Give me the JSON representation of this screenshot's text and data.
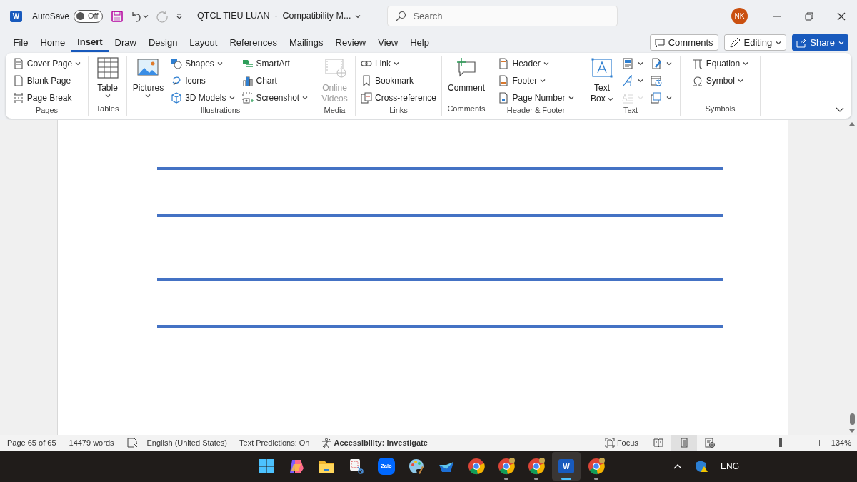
{
  "title_bar": {
    "app_letter": "W",
    "autosave": {
      "label": "AutoSave",
      "state_label": "Off",
      "on": false
    },
    "title": "QTCL TIEU LUAN  -  Compatibility M...",
    "search": {
      "placeholder": "Search"
    },
    "avatar": "NK"
  },
  "tabs": [
    {
      "label": "File",
      "selected": false
    },
    {
      "label": "Home",
      "selected": false
    },
    {
      "label": "Insert",
      "selected": true
    },
    {
      "label": "Draw",
      "selected": false
    },
    {
      "label": "Design",
      "selected": false
    },
    {
      "label": "Layout",
      "selected": false
    },
    {
      "label": "References",
      "selected": false
    },
    {
      "label": "Mailings",
      "selected": false
    },
    {
      "label": "Review",
      "selected": false
    },
    {
      "label": "View",
      "selected": false
    },
    {
      "label": "Help",
      "selected": false
    }
  ],
  "top_buttons": [
    {
      "label": "Comments",
      "kind": "outline"
    },
    {
      "label": "Editing",
      "kind": "menu"
    },
    {
      "label": "Share",
      "kind": "primary"
    }
  ],
  "ribbon": [
    {
      "label": "Pages",
      "columns": [
        {
          "kind": "stack",
          "items": [
            {
              "label": "Cover Page",
              "dropdown": true
            },
            {
              "label": "Blank Page",
              "dropdown": false
            },
            {
              "label": "Page Break",
              "dropdown": false
            }
          ]
        }
      ]
    },
    {
      "label": "Tables",
      "columns": [
        {
          "kind": "large",
          "label": "Table",
          "dropdown": true,
          "disabled": false
        }
      ]
    },
    {
      "label": "Illustrations",
      "columns": [
        {
          "kind": "large",
          "label": "Pictures",
          "dropdown": true,
          "disabled": false
        },
        {
          "kind": "stack",
          "items": [
            {
              "label": "Shapes",
              "dropdown": true
            },
            {
              "label": "Icons",
              "dropdown": false
            },
            {
              "label": "3D Models",
              "dropdown": true
            }
          ]
        },
        {
          "kind": "stack",
          "items": [
            {
              "label": "SmartArt",
              "dropdown": false
            },
            {
              "label": "Chart",
              "dropdown": false
            },
            {
              "label": "Screenshot",
              "dropdown": true
            }
          ]
        }
      ]
    },
    {
      "label": "Media",
      "columns": [
        {
          "kind": "large",
          "label": "Online Videos",
          "dropdown": false,
          "disabled": true
        }
      ]
    },
    {
      "label": "Links",
      "columns": [
        {
          "kind": "stack",
          "items": [
            {
              "label": "Link",
              "dropdown": true
            },
            {
              "label": "Bookmark",
              "dropdown": false
            },
            {
              "label": "Cross-reference",
              "dropdown": false
            }
          ]
        }
      ]
    },
    {
      "label": "Comments",
      "columns": [
        {
          "kind": "large",
          "label": "Comment",
          "dropdown": false,
          "disabled": false
        }
      ]
    },
    {
      "label": "Header & Footer",
      "columns": [
        {
          "kind": "stack",
          "items": [
            {
              "label": "Header",
              "dropdown": true
            },
            {
              "label": "Footer",
              "dropdown": true
            },
            {
              "label": "Page Number",
              "dropdown": true
            }
          ]
        }
      ]
    },
    {
      "label": "Text",
      "columns": [
        {
          "kind": "large",
          "label": "Text Box",
          "dropdown": true,
          "disabled": false
        },
        {
          "kind": "icons",
          "items": [
            {
              "dropdown": true,
              "disabled": false
            },
            {
              "dropdown": true,
              "disabled": false
            },
            {
              "dropdown": true,
              "disabled": true
            }
          ]
        },
        {
          "kind": "icons",
          "items": [
            {
              "dropdown": true,
              "disabled": false
            },
            {
              "dropdown": false,
              "disabled": false
            },
            {
              "dropdown": true,
              "disabled": false
            }
          ]
        }
      ]
    },
    {
      "label": "Symbols",
      "columns": [
        {
          "kind": "stack",
          "items": [
            {
              "label": "Equation",
              "dropdown": true
            },
            {
              "label": "Symbol",
              "dropdown": true
            }
          ]
        }
      ]
    }
  ],
  "document": {
    "rules": [
      {
        "kind": "line"
      },
      {
        "kind": "line"
      },
      {
        "kind": "line"
      },
      {
        "kind": "line"
      }
    ]
  },
  "status_bar": {
    "page": "Page 65 of 65",
    "words": "14479 words",
    "language": "English (United States)",
    "predictions": "Text Predictions: On",
    "accessibility": "Accessibility: Investigate",
    "focus": "Focus",
    "views": [
      {
        "kind": "read",
        "selected": false
      },
      {
        "kind": "print",
        "selected": true
      },
      {
        "kind": "web",
        "selected": false
      }
    ],
    "zoom": {
      "level": 0.54,
      "reading": "134%"
    }
  },
  "taskbar": {
    "apps": [
      {
        "kind": "start",
        "running": false,
        "selected": false
      },
      {
        "kind": "copilot",
        "running": false,
        "selected": false
      },
      {
        "kind": "folder",
        "running": false,
        "selected": false
      },
      {
        "kind": "snip",
        "running": false,
        "selected": false
      },
      {
        "kind": "zalo",
        "label": "Zalo",
        "running": false,
        "selected": false
      },
      {
        "kind": "paint",
        "running": false,
        "selected": false
      },
      {
        "kind": "feedback",
        "running": false,
        "selected": false
      },
      {
        "kind": "chrome",
        "running": false,
        "selected": false
      },
      {
        "kind": "chrome",
        "running": true,
        "selected": false
      },
      {
        "kind": "chrome",
        "running": true,
        "selected": false
      },
      {
        "kind": "word",
        "label": "W",
        "running": true,
        "selected": true
      },
      {
        "kind": "chrome",
        "running": true,
        "selected": false
      }
    ],
    "language": "ENG"
  }
}
